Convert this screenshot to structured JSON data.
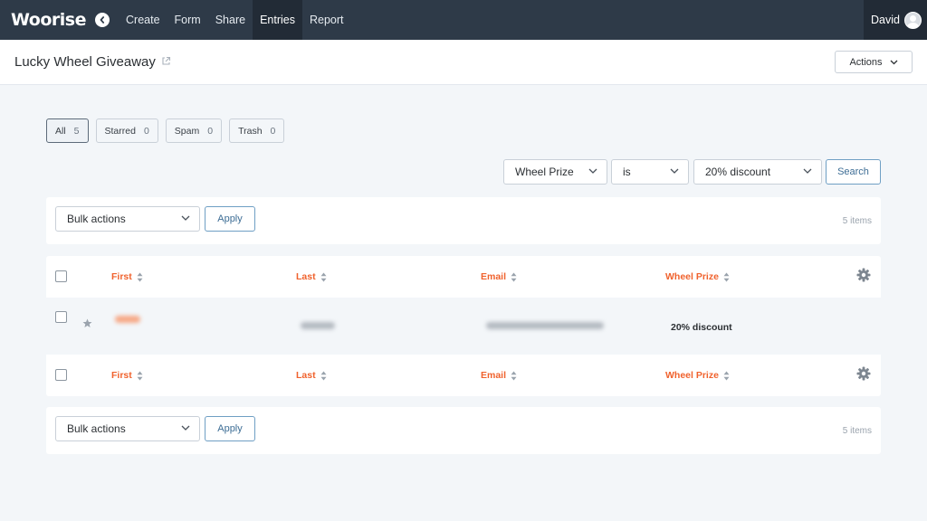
{
  "nav": {
    "logo": "Woorise",
    "items": [
      "Create",
      "Form",
      "Share",
      "Entries",
      "Report"
    ],
    "active": "Entries",
    "user": "David"
  },
  "header": {
    "title": "Lucky Wheel Giveaway",
    "actions_label": "Actions"
  },
  "filter_tabs": [
    {
      "label": "All",
      "count": "5"
    },
    {
      "label": "Starred",
      "count": "0"
    },
    {
      "label": "Spam",
      "count": "0"
    },
    {
      "label": "Trash",
      "count": "0"
    }
  ],
  "search": {
    "field": "Wheel Prize",
    "operator": "is",
    "value": "20% discount",
    "button": "Search"
  },
  "bulk": {
    "select_label": "Bulk actions",
    "apply_label": "Apply",
    "items_count": "5 items"
  },
  "table": {
    "columns": [
      "First",
      "Last",
      "Email",
      "Wheel Prize"
    ],
    "rows": [
      {
        "first": "",
        "last": "",
        "email": "",
        "wheel_prize": "20% discount",
        "first_redacted": true,
        "last_redacted": true,
        "email_redacted": true
      }
    ]
  },
  "icons": {
    "back": "chevron-left-icon",
    "external": "external-link-icon",
    "chevron": "chevron-down-icon",
    "sort": "sort-icon",
    "settings": "gear-icon",
    "star": "star-icon"
  },
  "colors": {
    "nav_bg": "#2e3a48",
    "accent": "#f0622d",
    "button_outline": "#6f9fc4"
  }
}
